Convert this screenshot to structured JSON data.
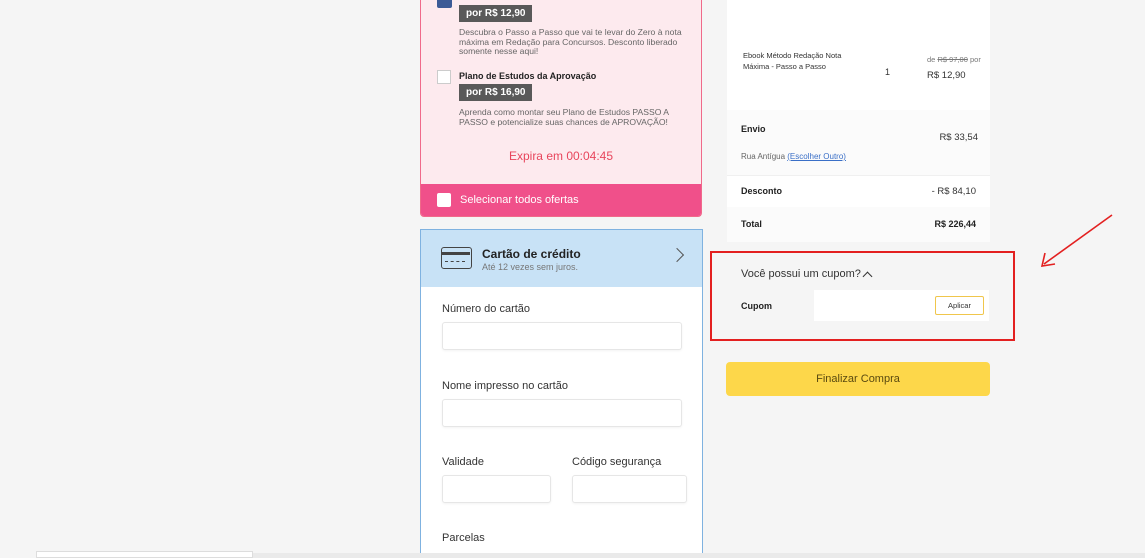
{
  "offers": {
    "item1": {
      "price": "por R$ 12,90",
      "description": "Descubra o Passo a Passo que vai te levar do Zero à nota máxima em Redação para Concursos. Desconto liberado somente nesse aqui!"
    },
    "item2": {
      "title": "Plano de Estudos da Aprovação",
      "price": "por R$ 16,90",
      "description": "Aprenda como montar seu Plano de Estudos PASSO A PASSO e potencialize suas chances de APROVAÇÃO!"
    },
    "expires": "Expira em 00:04:45",
    "select_all": "Selecionar todos ofertas"
  },
  "payment": {
    "title": "Cartão de crédito",
    "subtitle": "Até 12 vezes sem juros.",
    "card_number_label": "Número do cartão",
    "name_label": "Nome impresso no cartão",
    "validity_label": "Validade",
    "cvv_label": "Código segurança",
    "installments_label": "Parcelas"
  },
  "summary": {
    "item_name": "Ebook Método Redação Nota Máxima - Passo a Passo",
    "qty": "1",
    "old_price_prefix": "de ",
    "old_price": "R$ 97,00",
    "old_price_suffix": " por",
    "new_price": "R$ 12,90",
    "shipping_label": "Envio",
    "shipping_value": "R$ 33,54",
    "address": "Rua Antígua ",
    "address_link": "(Escolher Outro)",
    "discount_label": "Desconto",
    "discount_value": "- R$ 84,10",
    "total_label": "Total",
    "total_value": "R$ 226,44"
  },
  "coupon": {
    "question": "Você possui um cupom?",
    "label": "Cupom",
    "apply": "Aplicar"
  },
  "checkout_button": "Finalizar Compra",
  "colors": {
    "offer_bg": "#fdeaee",
    "offer_accent": "#f0508a",
    "card_header": "#c8e2f6",
    "buy_button": "#fdd74a",
    "highlight": "#e32020"
  }
}
